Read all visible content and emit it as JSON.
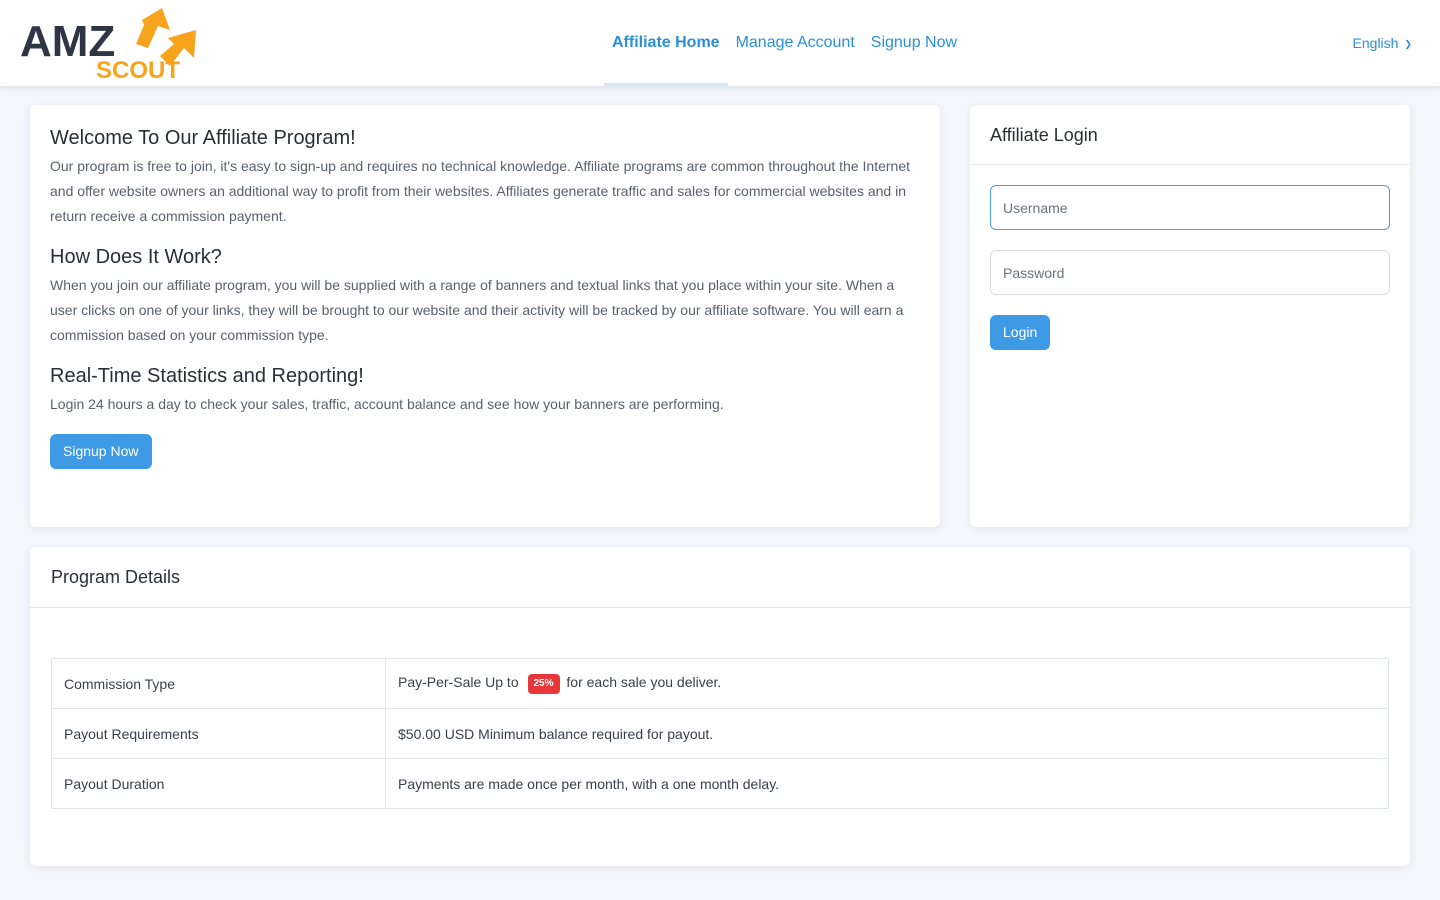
{
  "brand": {
    "logo_top": "AMZ",
    "logo_bottom": "SCOUT",
    "accent": "#f7a31c",
    "dark": "#2f3544"
  },
  "nav": {
    "items": [
      {
        "label": "Affiliate Home",
        "active": true
      },
      {
        "label": "Manage Account",
        "active": false
      },
      {
        "label": "Signup Now",
        "active": false
      }
    ],
    "language": "English"
  },
  "welcome": {
    "sections": [
      {
        "title": "Welcome To Our Affiliate Program!",
        "text": "Our program is free to join, it's easy to sign-up and requires no technical knowledge. Affiliate programs are common throughout the Internet and offer website owners an additional way to profit from their websites. Affiliates generate traffic and sales for commercial websites and in return receive a commission payment."
      },
      {
        "title": "How Does It Work?",
        "text": "When you join our affiliate program, you will be supplied with a range of banners and textual links that you place within your site. When a user clicks on one of your links, they will be brought to our website and their activity will be tracked by our affiliate software. You will earn a commission based on your commission type."
      },
      {
        "title": "Real-Time Statistics and Reporting!",
        "text": "Login 24 hours a day to check your sales, traffic, account balance and see how your banners are performing."
      }
    ],
    "signup_button": "Signup Now"
  },
  "login": {
    "title": "Affiliate Login",
    "username_placeholder": "Username",
    "password_placeholder": "Password",
    "button": "Login"
  },
  "details": {
    "title": "Program Details",
    "rows": [
      {
        "key": "Commission Type",
        "pre": "Pay-Per-Sale Up to",
        "badge": "25%",
        "post": "for each sale you deliver."
      },
      {
        "key": "Payout Requirements",
        "value": "$50.00 USD Minimum balance required for payout."
      },
      {
        "key": "Payout Duration",
        "value": "Payments are made once per month, with a one month delay."
      }
    ]
  },
  "colors": {
    "link": "#2b8fd6",
    "button": "#3f9ae5",
    "badge": "#e8373a",
    "background": "#f3f6fb"
  }
}
